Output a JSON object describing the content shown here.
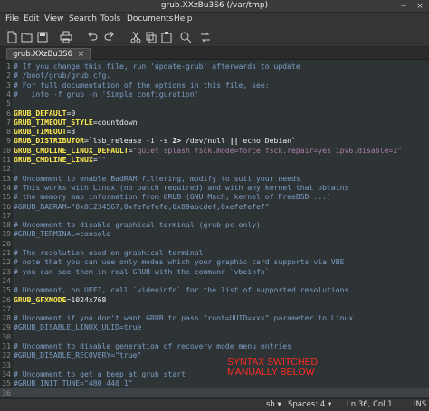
{
  "window": {
    "title": "grub.XXzBu3S6 (/var/tmp)",
    "minimize_glyph": "−",
    "close_glyph": "×"
  },
  "menu": [
    "File",
    "Edit",
    "View",
    "Search",
    "Tools",
    "Documents",
    "Help"
  ],
  "toolbar": [
    "new-document-icon",
    "open-icon",
    "save-icon",
    "print-icon",
    "undo-icon",
    "redo-icon",
    "cut-icon",
    "copy-icon",
    "paste-icon",
    "find-icon",
    "replace-icon"
  ],
  "tab": {
    "label": "grub.XXzBu3S6",
    "close": "×"
  },
  "editor": {
    "current_line": 36,
    "lines": [
      [
        [
          "c",
          "# If you change this file, run 'update-grub' afterwards to update"
        ]
      ],
      [
        [
          "c",
          "# /boot/grub/grub.cfg."
        ]
      ],
      [
        [
          "c",
          "# For full documentation of the options in this file, see:"
        ]
      ],
      [
        [
          "c",
          "#   info -f grub -n 'Simple configuration'"
        ]
      ],
      [],
      [
        [
          "k",
          "GRUB_DEFAULT"
        ],
        [
          "t",
          "=0"
        ]
      ],
      [
        [
          "k",
          "GRUB_TIMEOUT_STYLE"
        ],
        [
          "t",
          "=countdown"
        ]
      ],
      [
        [
          "k",
          "GRUB_TIMEOUT"
        ],
        [
          "t",
          "=3"
        ]
      ],
      [
        [
          "k",
          "GRUB_DISTRIBUTOR"
        ],
        [
          "t",
          "=`lsb_release -i -s "
        ],
        [
          "o",
          "2>"
        ],
        [
          "t",
          " /dev/null "
        ],
        [
          "o",
          "||"
        ],
        [
          "t",
          " echo Debian`"
        ]
      ],
      [
        [
          "k",
          "GRUB_CMDLINE_LINUX_DEFAULT"
        ],
        [
          "t",
          "="
        ],
        [
          "s",
          "\"quiet splash fsck.mode=force fsck.repair=yes ipv6.disable=1\""
        ]
      ],
      [
        [
          "k",
          "GRUB_CMDLINE_LINUX"
        ],
        [
          "t",
          "="
        ],
        [
          "s",
          "\"\""
        ]
      ],
      [],
      [
        [
          "c",
          "# Uncomment to enable BadRAM filtering, modify to suit your needs"
        ]
      ],
      [
        [
          "c",
          "# This works with Linux (no patch required) and with any kernel that obtains"
        ]
      ],
      [
        [
          "c",
          "# the memory map information from GRUB (GNU Mach, kernel of FreeBSD ...)"
        ]
      ],
      [
        [
          "c",
          "#GRUB_BADRAM=\"0x01234567,0xfefefefe,0x89abcdef,0xefefefef\""
        ]
      ],
      [],
      [
        [
          "c",
          "# Uncomment to disable graphical terminal (grub-pc only)"
        ]
      ],
      [
        [
          "c",
          "#GRUB_TERMINAL=console"
        ]
      ],
      [],
      [
        [
          "c",
          "# The resolution used on graphical terminal"
        ]
      ],
      [
        [
          "c",
          "# note that you can use only modes which your graphic card supports via VBE"
        ]
      ],
      [
        [
          "c",
          "# you can see them in real GRUB with the command `vbeinfo`"
        ]
      ],
      [],
      [
        [
          "c",
          "# Uncomment, on UEFI, call `videoinfo` for the list of supported resolutions."
        ]
      ],
      [
        [
          "k",
          "GRUB_GFXMODE"
        ],
        [
          "t",
          "=1024x768"
        ]
      ],
      [],
      [
        [
          "c",
          "# Uncomment if you don't want GRUB to pass \"root=UUID=xxx\" parameter to Linux"
        ]
      ],
      [
        [
          "c",
          "#GRUB_DISABLE_LINUX_UUID=true"
        ]
      ],
      [],
      [
        [
          "c",
          "# Uncomment to disable generation of recovery mode menu entries"
        ]
      ],
      [
        [
          "c",
          "#GRUB_DISABLE_RECOVERY=\"true\""
        ]
      ],
      [],
      [
        [
          "c",
          "# Uncomment to get a beep at grub start"
        ]
      ],
      [
        [
          "c",
          "#GRUB_INIT_TUNE=\"480 440 1\""
        ]
      ],
      []
    ]
  },
  "overlay": {
    "line1": "SYNTAX SWITCHED",
    "line2": "MANUALLY BELOW",
    "color": "#ff2a1f"
  },
  "status": {
    "language": "sh",
    "spaces": "Spaces: 4",
    "position": "Ln 36, Col 1",
    "mode": "INS",
    "dropdown_glyph": "▾"
  }
}
